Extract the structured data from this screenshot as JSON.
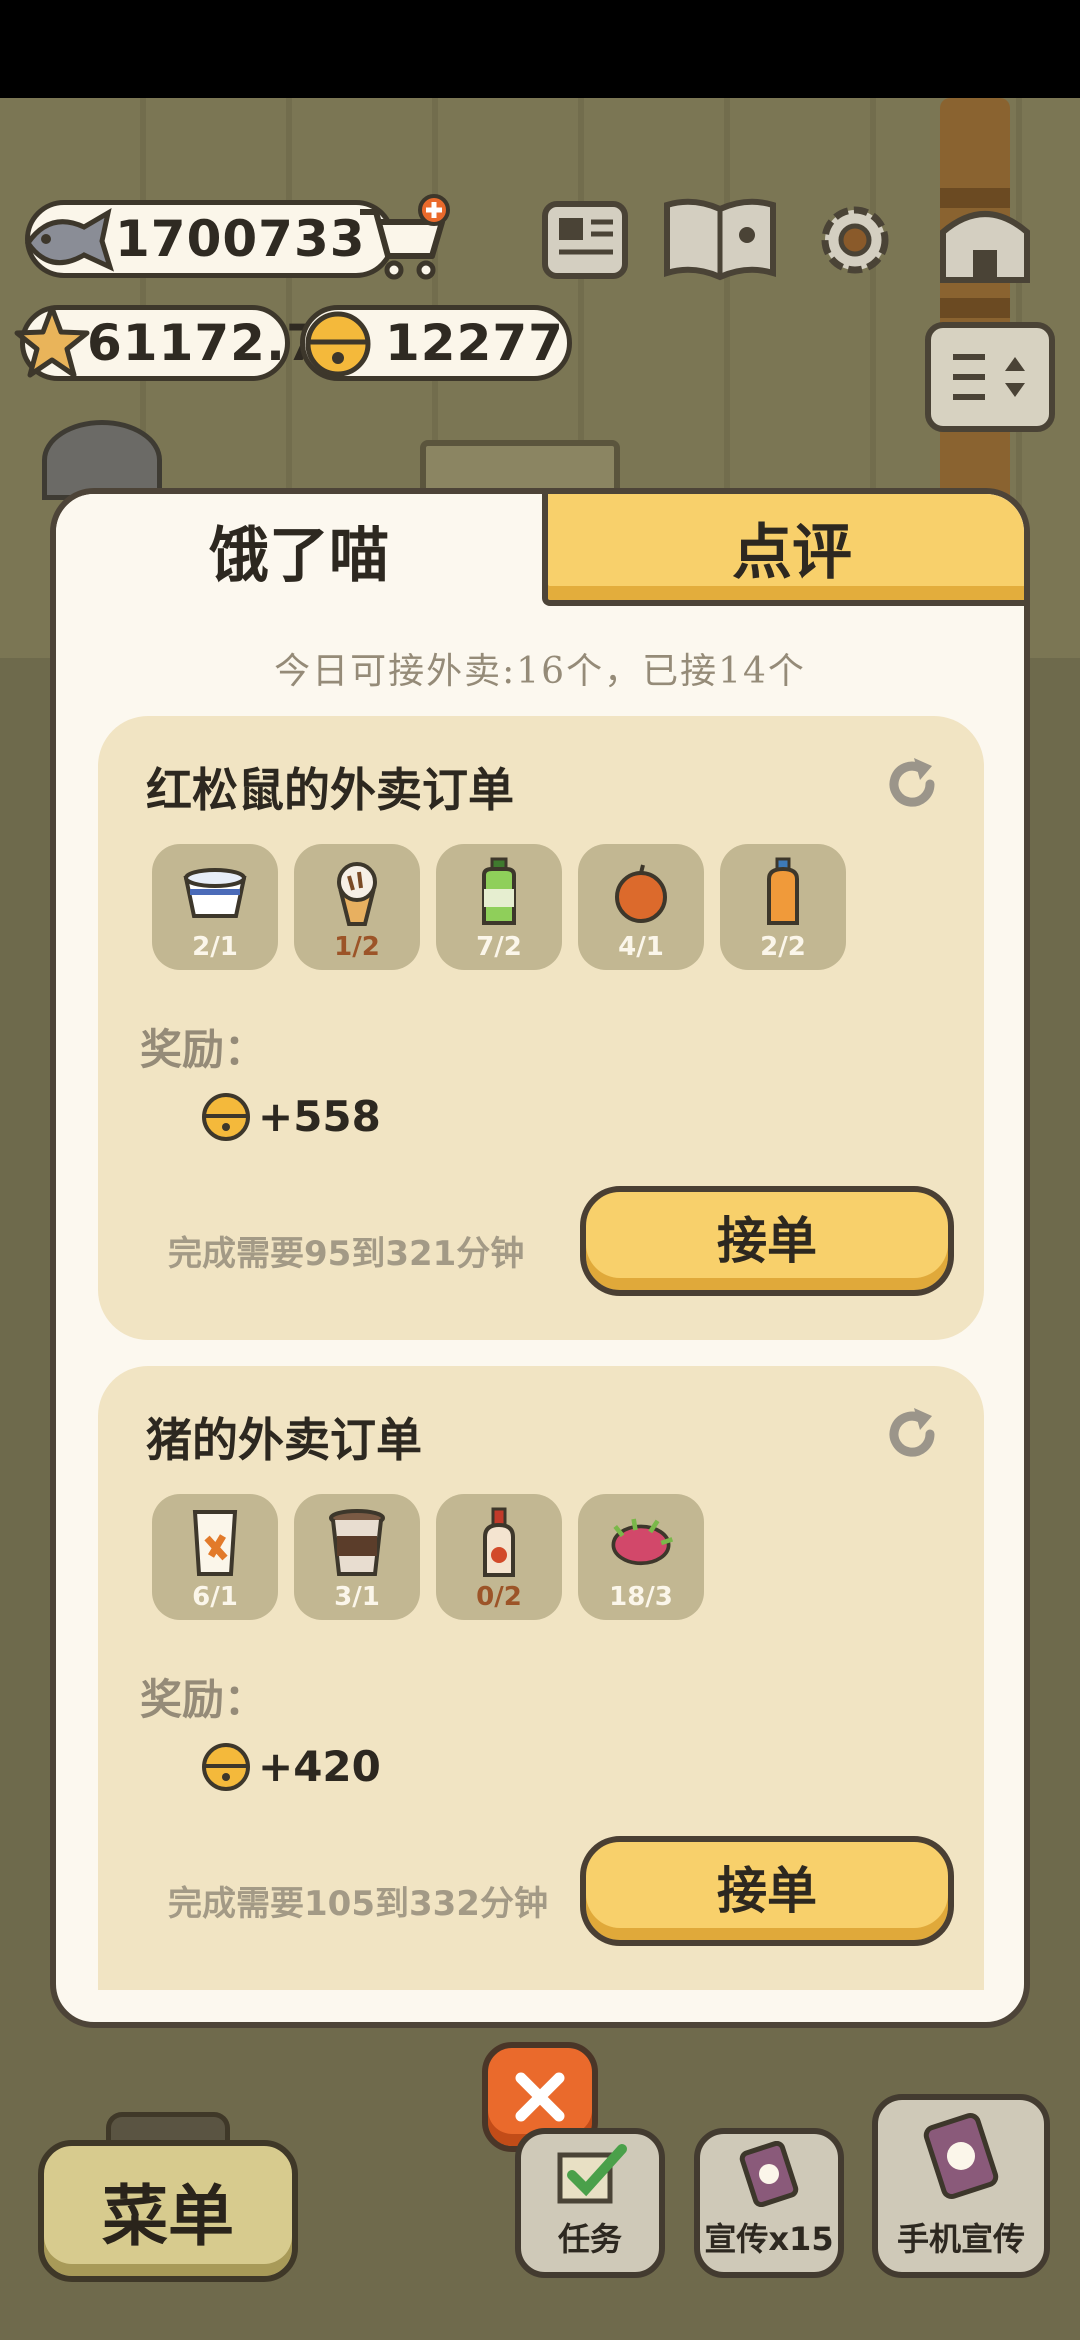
{
  "resources": {
    "fish": "1700733",
    "stars": "61172.7",
    "bells": "12277"
  },
  "tabs": {
    "active": "饿了喵",
    "inactive": "点评"
  },
  "quota_text": "今日可接外卖:16个，已接14个",
  "orders": [
    {
      "title": "红松鼠的外卖订单",
      "items": [
        {
          "icon": "bowl-icon",
          "count": "2/1",
          "short": false
        },
        {
          "icon": "ice-cream-icon",
          "count": "1/2",
          "short": true
        },
        {
          "icon": "green-bottle-icon",
          "count": "7/2",
          "short": false
        },
        {
          "icon": "apple-icon",
          "count": "4/1",
          "short": false
        },
        {
          "icon": "juice-bottle-icon",
          "count": "2/2",
          "short": false
        }
      ],
      "reward_label": "奖励：",
      "reward_value": "+558",
      "duration": "完成需要95到321分钟",
      "accept_label": "接单"
    },
    {
      "title": "猪的外卖订单",
      "items": [
        {
          "icon": "snack-bag-icon",
          "count": "6/1",
          "short": false
        },
        {
          "icon": "coffee-cup-icon",
          "count": "3/1",
          "short": false
        },
        {
          "icon": "sauce-bottle-icon",
          "count": "0/2",
          "short": true
        },
        {
          "icon": "dragon-fruit-icon",
          "count": "18/3",
          "short": false
        }
      ],
      "reward_label": "奖励：",
      "reward_value": "+420",
      "duration": "完成需要105到332分钟",
      "accept_label": "接单"
    }
  ],
  "bottom": {
    "menu": "菜单",
    "task": "任务",
    "promo": "宣传x15",
    "phone": "手机宣传"
  },
  "colors": {
    "accent_yellow": "#f8d06b",
    "panel_bg": "#fcf8ef",
    "card_bg": "#f1e4c3",
    "item_bg": "#c2b792",
    "close_orange": "#ea6a2c",
    "short_count": "#9c5428"
  }
}
